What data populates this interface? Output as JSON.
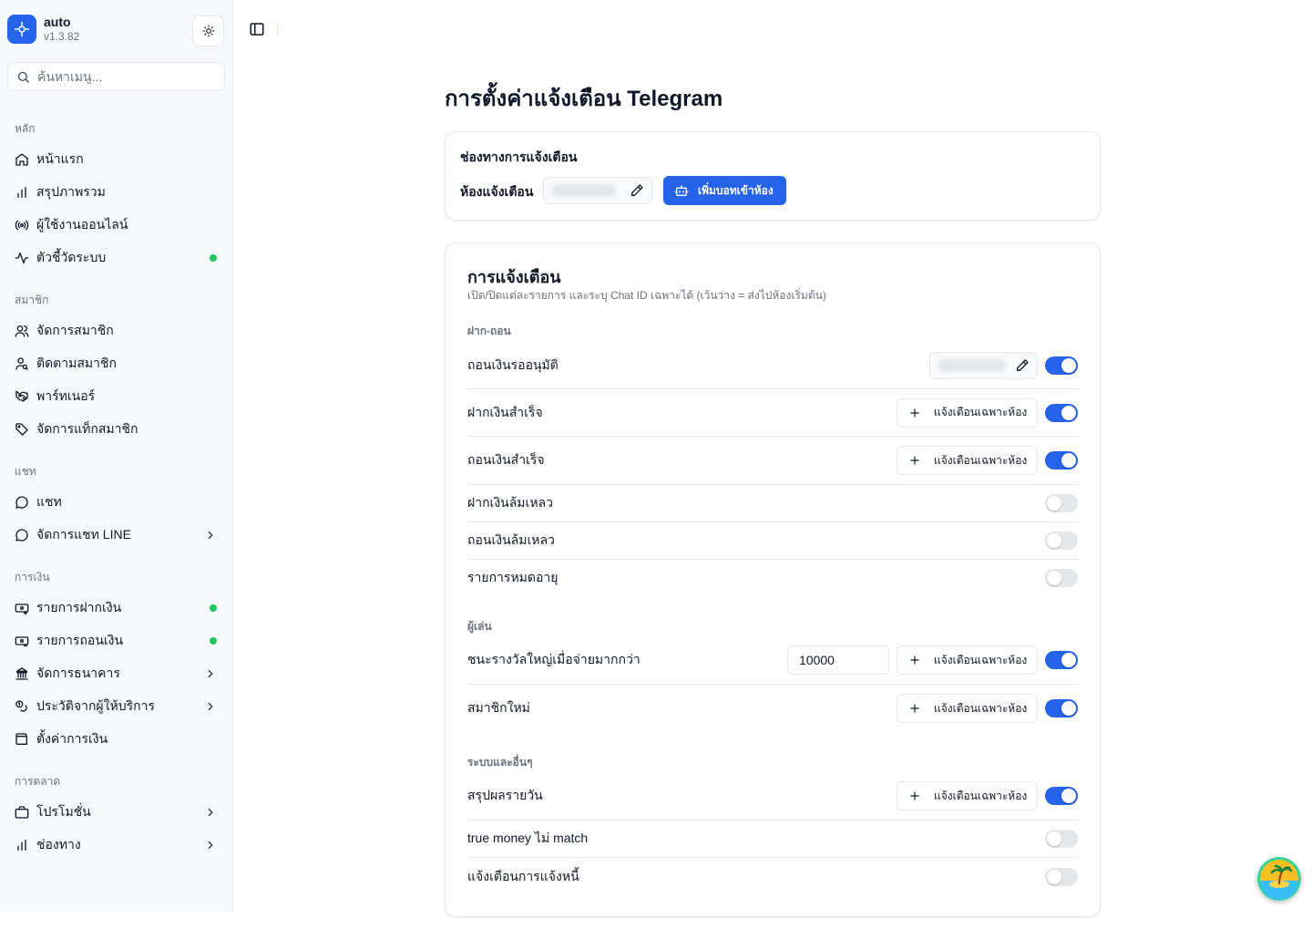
{
  "app": {
    "name": "auto",
    "version": "v1.3.82"
  },
  "search": {
    "placeholder": "ค้นหาเมนู..."
  },
  "sidebar": {
    "sections": [
      {
        "label": "หลัก",
        "items": [
          {
            "label": "หน้าแรก",
            "icon": "home-icon"
          },
          {
            "label": "สรุปภาพรวม",
            "icon": "bar-chart-icon"
          },
          {
            "label": "ผู้ใช้งานออนไลน์",
            "icon": "radio-icon"
          },
          {
            "label": "ตัวชี้วัดระบบ",
            "icon": "activity-icon",
            "status": "online"
          }
        ]
      },
      {
        "label": "สมาชิก",
        "items": [
          {
            "label": "จัดการสมาชิก",
            "icon": "users-icon"
          },
          {
            "label": "ติดตามสมาชิก",
            "icon": "user-search-icon"
          },
          {
            "label": "พาร์ทเนอร์",
            "icon": "handshake-icon"
          },
          {
            "label": "จัดการแท็กสมาชิก",
            "icon": "tag-icon"
          }
        ]
      },
      {
        "label": "แชท",
        "items": [
          {
            "label": "แชท",
            "icon": "chat-icon"
          },
          {
            "label": "จัดการแชท LINE",
            "icon": "chat-icon",
            "expandable": true
          }
        ]
      },
      {
        "label": "การเงิน",
        "items": [
          {
            "label": "รายการฝากเงิน",
            "icon": "money-in-icon",
            "status": "online"
          },
          {
            "label": "รายการถอนเงิน",
            "icon": "money-out-icon",
            "status": "online"
          },
          {
            "label": "จัดการธนาคาร",
            "icon": "bank-icon",
            "expandable": true
          },
          {
            "label": "ประวัติจากผู้ให้บริการ",
            "icon": "coins-icon",
            "expandable": true
          },
          {
            "label": "ตั้งค่าการเงิน",
            "icon": "wallet-icon"
          }
        ]
      },
      {
        "label": "การตลาด",
        "items": [
          {
            "label": "โปรโมชั่น",
            "icon": "promo-icon",
            "expandable": true
          },
          {
            "label": "ช่องทาง",
            "icon": "bar-chart-icon",
            "expandable": true
          }
        ]
      }
    ]
  },
  "page": {
    "title": "การตั้งค่าแจ้งเตือน Telegram"
  },
  "channel_card": {
    "title": "ช่องทางการแจ้งเตือน",
    "room_label": "ห้องแจ้งเตือน",
    "add_bot_button": "เพิ่มบอทเข้าห้อง"
  },
  "notify_card": {
    "title": "การแจ้งเตือน",
    "subtitle": "เปิด/ปิดแต่ละรายการ และระบุ Chat ID เฉพาะได้ (เว้นว่าง = ส่งไปห้องเริ่มต้น)",
    "room_button_label": "แจ้งเตือนเฉพาะห้อง",
    "groups": [
      {
        "label": "ฝาก-ถอน",
        "rows": [
          {
            "label": "ถอนเงินรออนุมัติ",
            "enabled": true,
            "control": "chat-id-field"
          },
          {
            "label": "ฝากเงินสำเร็จ",
            "enabled": true,
            "control": "room-button"
          },
          {
            "label": "ถอนเงินสำเร็จ",
            "enabled": true,
            "control": "room-button"
          },
          {
            "label": "ฝากเงินล้มเหลว",
            "enabled": false
          },
          {
            "label": "ถอนเงินล้มเหลว",
            "enabled": false
          },
          {
            "label": "รายการหมดอายุ",
            "enabled": false
          }
        ]
      },
      {
        "label": "ผู้เล่น",
        "rows": [
          {
            "label": "ชนะรางวัลใหญ่เมื่อจ่ายมากกว่า",
            "enabled": true,
            "control": "room-button",
            "threshold": "10000"
          },
          {
            "label": "สมาชิกใหม่",
            "enabled": true,
            "control": "room-button"
          }
        ]
      },
      {
        "label": "ระบบและอื่นๆ",
        "rows": [
          {
            "label": "สรุปผลรายวัน",
            "enabled": true,
            "control": "room-button"
          },
          {
            "label": "true money ไม่ match",
            "enabled": false
          },
          {
            "label": "แจ้งเตือนการแจ้งหนี้",
            "enabled": false
          }
        ]
      }
    ]
  },
  "colors": {
    "accent": "#2563eb",
    "status_online": "#22c55e",
    "border": "#e5e7eb",
    "muted_text": "#6b7280"
  }
}
